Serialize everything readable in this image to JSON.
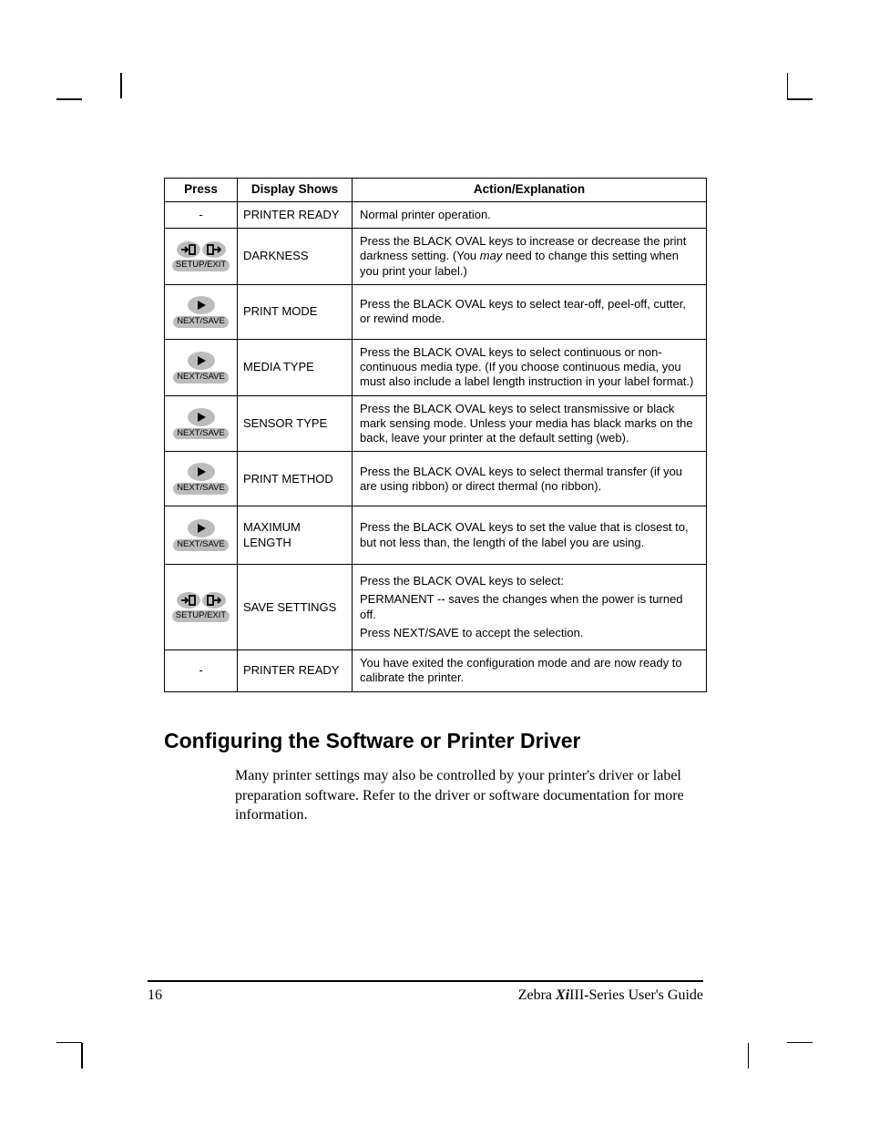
{
  "table": {
    "headers": {
      "press": "Press",
      "display": "Display Shows",
      "action": "Action/Explanation"
    },
    "rows": [
      {
        "key": "none",
        "press_label": "-",
        "display": "PRINTER READY",
        "action": "Normal printer operation."
      },
      {
        "key": "setup_exit",
        "label": "SETUP/EXIT",
        "display": "DARKNESS",
        "action_pre": "Press the BLACK OVAL keys to increase or decrease the print darkness setting.  (You ",
        "action_em": "may",
        "action_post": " need to change this setting when you print your label.)"
      },
      {
        "key": "next_save",
        "label": "NEXT/SAVE",
        "display": "PRINT MODE",
        "action": "Press the BLACK OVAL keys to select tear-off, peel-off, cutter, or rewind mode."
      },
      {
        "key": "next_save",
        "label": "NEXT/SAVE",
        "display": "MEDIA TYPE",
        "action": "Press the BLACK OVAL keys to select continuous or non-continuous media type.  (If you choose continuous media, you must also include a label length instruction in your label format.)"
      },
      {
        "key": "next_save",
        "label": "NEXT/SAVE",
        "display": "SENSOR TYPE",
        "action": "Press the BLACK OVAL keys to select transmissive or black mark sensing mode.  Unless your media has black marks on the back, leave your printer at the default setting (web)."
      },
      {
        "key": "next_save",
        "label": "NEXT/SAVE",
        "display": "PRINT METHOD",
        "action": "Press the BLACK OVAL keys to select thermal transfer (if you are using ribbon) or direct thermal (no ribbon)."
      },
      {
        "key": "next_save",
        "label": "NEXT/SAVE",
        "display": "MAXIMUM LENGTH",
        "action": "Press the BLACK OVAL keys to set the value that is closest to, but not less than, the length of the label you are using."
      },
      {
        "key": "setup_exit",
        "label": "SETUP/EXIT",
        "display": "SAVE SETTINGS",
        "actions": [
          "Press the BLACK OVAL keys to select:",
          "PERMANENT -- saves the changes when the power is turned off.",
          "Press NEXT/SAVE to accept the selection."
        ]
      },
      {
        "key": "none",
        "press_label": "-",
        "display": "PRINTER READY",
        "action": "You have exited the configuration mode and are now ready to calibrate the printer."
      }
    ]
  },
  "section_heading": "Configuring the Software or Printer Driver",
  "section_body": "Many printer settings may also be controlled by your printer's driver or label preparation software.  Refer to the driver or software documentation for more information.",
  "footer": {
    "page_number": "16",
    "title_pre": "Zebra ",
    "title_xi": "Xi",
    "title_post": "III-Series User's Guide"
  }
}
